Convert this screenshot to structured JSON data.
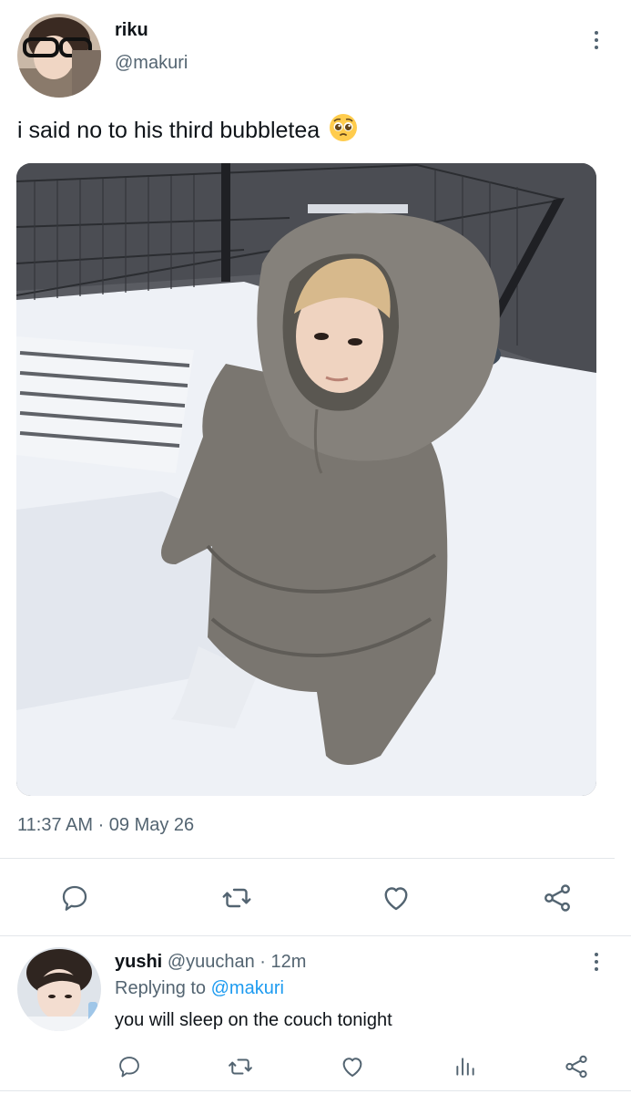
{
  "tweet": {
    "author_name": "riku",
    "author_handle": "@makuri",
    "text": "i said no to his third bubbletea",
    "emoji": "pleading-face",
    "timestamp": "11:37 AM · 09 May 26",
    "actions": [
      "reply-icon",
      "retweet-icon",
      "like-icon",
      "share-icon"
    ]
  },
  "reply": {
    "author_name": "yushi",
    "author_handle": "@yuuchan",
    "separator": "·",
    "time": "12m",
    "replying_prefix": "Replying to",
    "replying_mention": "@makuri",
    "text": "you will sleep on the couch tonight",
    "actions": [
      "reply-icon",
      "retweet-icon",
      "like-icon",
      "analytics-icon",
      "share-icon"
    ]
  },
  "colors": {
    "text": "#0f1419",
    "secondary": "#536471",
    "link": "#1d9bf0",
    "divider": "#e3e6ea"
  }
}
